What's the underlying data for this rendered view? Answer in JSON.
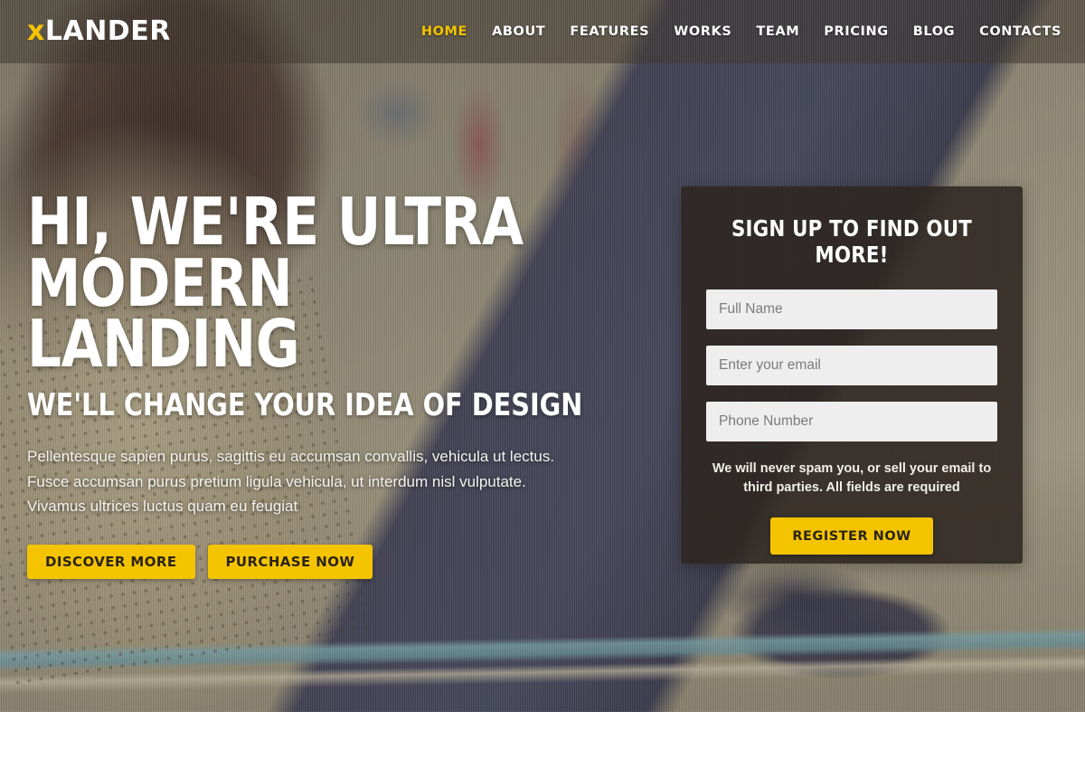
{
  "header": {
    "logo_x": "x",
    "logo_rest": "LANDER",
    "nav": [
      {
        "label": "HOME",
        "active": true
      },
      {
        "label": "ABOUT",
        "active": false
      },
      {
        "label": "FEATURES",
        "active": false
      },
      {
        "label": "WORKS",
        "active": false
      },
      {
        "label": "TEAM",
        "active": false
      },
      {
        "label": "PRICING",
        "active": false
      },
      {
        "label": "BLOG",
        "active": false
      },
      {
        "label": "CONTACTS",
        "active": false
      }
    ]
  },
  "hero": {
    "headline_line1": "HI, WE'RE ULTRA",
    "headline_line2": "MODERN LANDING",
    "subheadline": "WE'LL CHANGE YOUR IDEA OF DESIGN",
    "lead_line1": "Pellentesque sapien purus, sagittis eu accumsan convallis, vehicula ut lectus.",
    "lead_line2": "Fusce accumsan purus pretium ligula vehicula, ut interdum nisl vulputate.",
    "lead_line3": "Vivamus ultrices luctus quam eu feugiat",
    "primary_button": "DISCOVER MORE",
    "secondary_button": "PURCHASE NOW"
  },
  "signup": {
    "title": "SIGN UP TO FIND OUT MORE!",
    "name_placeholder": "Full Name",
    "name_value": "",
    "email_placeholder": "Enter your email",
    "email_value": "",
    "phone_placeholder": "Phone Number",
    "phone_value": "",
    "note": "We will never spam you, or sell your email to third parties. All fields are required",
    "submit_label": "REGISTER NOW"
  },
  "colors": {
    "accent_yellow": "#f5c400",
    "accent_text_dark": "#2b2413",
    "header_overlay": "rgba(58,50,40,.52)",
    "panel_dark": "rgba(45,38,33,.88)",
    "input_bg": "#eeeeee",
    "text_white": "#ffffff"
  }
}
